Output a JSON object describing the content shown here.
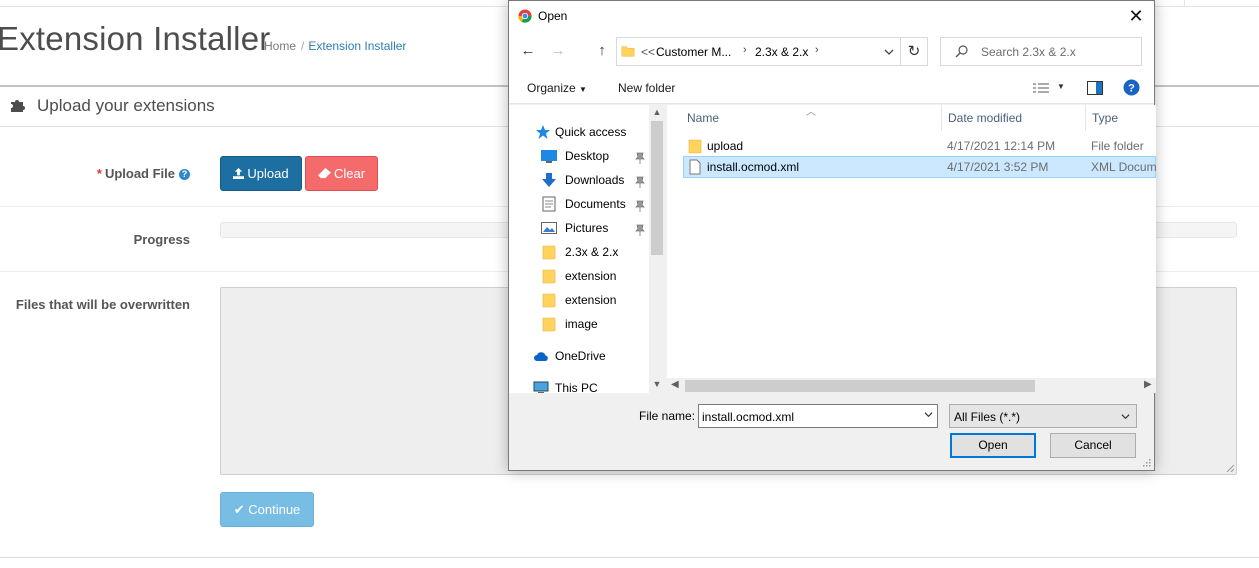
{
  "page": {
    "title": "Extension Installer",
    "breadcrumb": {
      "home": "Home",
      "separator": "/",
      "current": "Extension Installer"
    },
    "panel_heading": "Upload your extensions",
    "upload_file": {
      "required_mark": "*",
      "label": "Upload File",
      "help_icon": "question-circle-icon"
    },
    "upload_button": "Upload",
    "clear_button": "Clear",
    "progress_label": "Progress",
    "progress_value": 0,
    "overwrite_label": "Files that will be overwritten",
    "continue_button": "Continue",
    "colors": {
      "primary": "#1e6fa1",
      "danger": "#f56b6b",
      "info": "#78bde3",
      "link": "#2c7db4"
    }
  },
  "dialog": {
    "title": "Open",
    "app_icon": "chrome-icon",
    "address": {
      "overflow": "<<",
      "crumbs": [
        "Customer M...",
        "2.3x & 2.x"
      ]
    },
    "search_placeholder": "Search 2.3x & 2.x",
    "toolbar": {
      "organize": "Organize",
      "new_folder": "New folder"
    },
    "nav_items": [
      {
        "label": "Quick access",
        "icon": "star-icon",
        "pinned": false
      },
      {
        "label": "Desktop",
        "icon": "desktop-icon",
        "pinned": true
      },
      {
        "label": "Downloads",
        "icon": "downloads-icon",
        "pinned": true
      },
      {
        "label": "Documents",
        "icon": "documents-icon",
        "pinned": true
      },
      {
        "label": "Pictures",
        "icon": "pictures-icon",
        "pinned": true
      },
      {
        "label": "2.3x & 2.x",
        "icon": "folder-icon",
        "pinned": false
      },
      {
        "label": "extension",
        "icon": "folder-icon",
        "pinned": false
      },
      {
        "label": "extension",
        "icon": "folder-icon",
        "pinned": false
      },
      {
        "label": "image",
        "icon": "folder-icon",
        "pinned": false
      },
      {
        "label": "OneDrive",
        "icon": "cloud-icon",
        "pinned": false
      },
      {
        "label": "This PC",
        "icon": "computer-icon",
        "pinned": false
      }
    ],
    "columns": {
      "name": "Name",
      "date": "Date modified",
      "type": "Type"
    },
    "files": [
      {
        "name": "upload",
        "date": "4/17/2021 12:14 PM",
        "type": "File folder",
        "icon": "folder-icon",
        "selected": false
      },
      {
        "name": "install.ocmod.xml",
        "date": "4/17/2021 3:52 PM",
        "type": "XML Document",
        "icon": "file-icon",
        "selected": true
      }
    ],
    "file_name_label": "File name:",
    "file_name_value": "install.ocmod.xml",
    "filter_value": "All Files (*.*)",
    "open_button": "Open",
    "cancel_button": "Cancel"
  }
}
